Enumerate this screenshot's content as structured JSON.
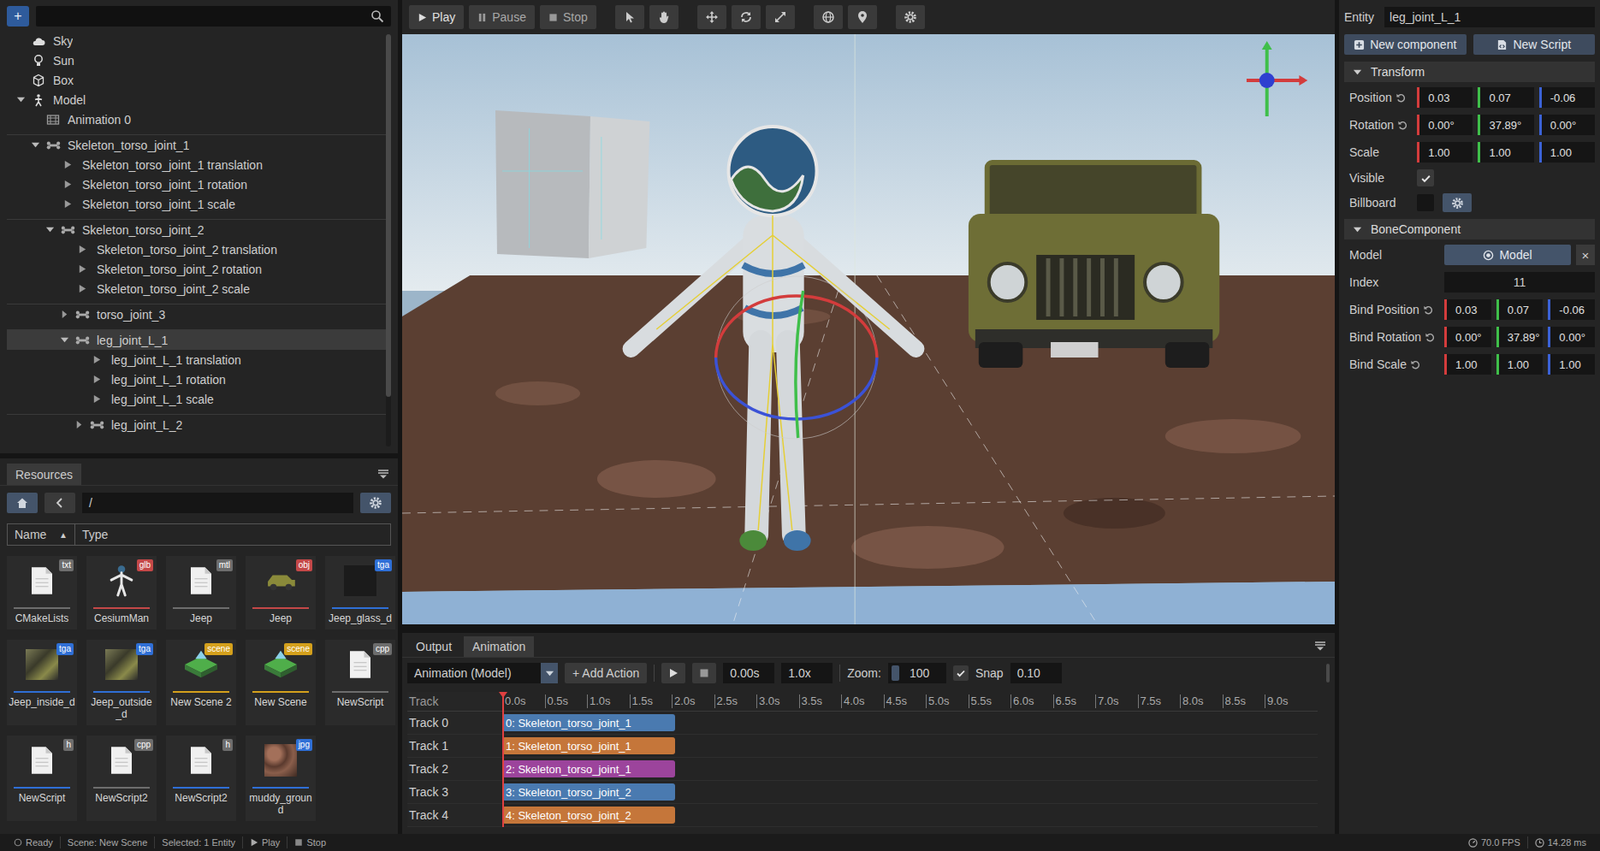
{
  "hierarchy": {
    "add_button": "+",
    "items": [
      {
        "label": "Sky",
        "kind": "sky",
        "depth": 0,
        "selected": false
      },
      {
        "label": "Sun",
        "kind": "light",
        "depth": 0,
        "selected": false
      },
      {
        "label": "Box",
        "kind": "box",
        "depth": 0,
        "selected": false
      },
      {
        "label": "Model",
        "kind": "model",
        "depth": 0,
        "expanded": true,
        "selected": false
      },
      {
        "label": "Animation 0",
        "kind": "animation",
        "depth": 1,
        "selected": false
      },
      {
        "label": "Skeleton_torso_joint_1",
        "kind": "bone",
        "depth": 1,
        "expanded": true,
        "selected": false
      },
      {
        "label": "Skeleton_torso_joint_1 translation",
        "kind": "track",
        "depth": 2,
        "selected": false
      },
      {
        "label": "Skeleton_torso_joint_1 rotation",
        "kind": "track",
        "depth": 2,
        "selected": false
      },
      {
        "label": "Skeleton_torso_joint_1 scale",
        "kind": "track",
        "depth": 2,
        "selected": false
      },
      {
        "label": "Skeleton_torso_joint_2",
        "kind": "bone",
        "depth": 2,
        "expanded": true,
        "selected": false
      },
      {
        "label": "Skeleton_torso_joint_2 translation",
        "kind": "track",
        "depth": 3,
        "selected": false
      },
      {
        "label": "Skeleton_torso_joint_2 rotation",
        "kind": "track",
        "depth": 3,
        "selected": false
      },
      {
        "label": "Skeleton_torso_joint_2 scale",
        "kind": "track",
        "depth": 3,
        "selected": false
      },
      {
        "label": "torso_joint_3",
        "kind": "bone",
        "depth": 3,
        "expanded": false,
        "selected": false
      },
      {
        "label": "leg_joint_L_1",
        "kind": "bone",
        "depth": 3,
        "expanded": true,
        "selected": true
      },
      {
        "label": "leg_joint_L_1 translation",
        "kind": "track",
        "depth": 4,
        "selected": false
      },
      {
        "label": "leg_joint_L_1 rotation",
        "kind": "track",
        "depth": 4,
        "selected": false
      },
      {
        "label": "leg_joint_L_1 scale",
        "kind": "track",
        "depth": 4,
        "selected": false
      },
      {
        "label": "leg_joint_L_2",
        "kind": "bone",
        "depth": 4,
        "expanded": false,
        "selected": false
      }
    ]
  },
  "resources": {
    "tab": "Resources",
    "path": "/",
    "columns": [
      {
        "label": "Name",
        "sort": "▲"
      },
      {
        "label": "Type"
      }
    ],
    "files": [
      {
        "name": "CMakeLists",
        "ext": "txt",
        "kind": "doc",
        "color": "#6d6d6d",
        "line_color": "#6d6d6d"
      },
      {
        "name": "CesiumMan",
        "ext": "glb",
        "kind": "figure",
        "color": "#c44848",
        "line_color": "#c44848"
      },
      {
        "name": "Jeep",
        "ext": "mtl",
        "kind": "doc",
        "color": "#6d6d6d",
        "line_color": "#6d6d6d"
      },
      {
        "name": "Jeep",
        "ext": "obj",
        "kind": "jeep",
        "color": "#c44848",
        "line_color": "#c44848"
      },
      {
        "name": "Jeep_glass_d",
        "ext": "tga",
        "kind": "dark",
        "color": "#2f6fd6",
        "line_color": "#2f6fd6"
      },
      {
        "name": "Jeep_inside_d",
        "ext": "tga",
        "kind": "texture",
        "color": "#2f6fd6",
        "line_color": "#2f6fd6"
      },
      {
        "name": "Jeep_outside_d",
        "ext": "tga",
        "kind": "texture",
        "color": "#2f6fd6",
        "line_color": "#2f6fd6"
      },
      {
        "name": "New Scene 2",
        "ext": "scene",
        "kind": "scene",
        "color": "#d4a01c",
        "line_color": "#d4a01c"
      },
      {
        "name": "New Scene",
        "ext": "scene",
        "kind": "scene",
        "color": "#d4a01c",
        "line_color": "#d4a01c"
      },
      {
        "name": "NewScript",
        "ext": "cpp",
        "kind": "doc",
        "color": "#6d6d6d",
        "line_color": "#6d6d6d"
      },
      {
        "name": "NewScript",
        "ext": "h",
        "kind": "doc",
        "color": "#6d6d6d",
        "line_color": "#2f6fd6"
      },
      {
        "name": "NewScript2",
        "ext": "cpp",
        "kind": "doc",
        "color": "#6d6d6d",
        "line_color": "#6d6d6d"
      },
      {
        "name": "NewScript2",
        "ext": "h",
        "kind": "doc",
        "color": "#6d6d6d",
        "line_color": "#2f6fd6"
      },
      {
        "name": "muddy_ground",
        "ext": "jpg",
        "kind": "mud",
        "color": "#2f6fd6",
        "line_color": "#2f6fd6"
      }
    ]
  },
  "toolbar": {
    "playback": [
      {
        "kind": "play",
        "label": "Play"
      },
      {
        "kind": "pause",
        "label": "Pause"
      },
      {
        "kind": "stop",
        "label": "Stop"
      }
    ],
    "tool_groups": [
      {
        "tools": [
          {
            "kind": "select"
          },
          {
            "kind": "pan"
          }
        ]
      },
      {
        "tools": [
          {
            "kind": "move"
          },
          {
            "kind": "rotate"
          },
          {
            "kind": "scale"
          }
        ]
      },
      {
        "tools": [
          {
            "kind": "world"
          },
          {
            "kind": "pin"
          }
        ]
      },
      {
        "tools": [
          {
            "kind": "settings"
          }
        ]
      }
    ]
  },
  "bottom_panel": {
    "tabs": [
      {
        "label": "Output",
        "selected": false
      },
      {
        "label": "Animation",
        "selected": true
      }
    ],
    "animation": {
      "select": "Animation (Model)",
      "add_action": "+ Add Action",
      "time": "0.00s",
      "speed": "1.0x",
      "zoom_label": "Zoom:",
      "zoom": "100",
      "snap": {
        "checked": true,
        "label": "Snap",
        "value": "0.10"
      }
    },
    "timeline": {
      "header": "Track",
      "ticks": [
        "0.0s",
        "0.5s",
        "1.0s",
        "1.5s",
        "2.0s",
        "2.5s",
        "3.0s",
        "3.5s",
        "4.0s",
        "4.5s",
        "5.0s",
        "5.5s",
        "6.0s",
        "6.5s",
        "7.0s",
        "7.5s",
        "8.0s",
        "8.5s",
        "9.0s"
      ],
      "playhead": 0,
      "tracks": [
        {
          "label": "Track 0",
          "clip": "0: Skeleton_torso_joint_1",
          "color": "#4a7ab0",
          "start": 0,
          "end": 2.0
        },
        {
          "label": "Track 1",
          "clip": "1: Skeleton_torso_joint_1",
          "color": "#c5763a",
          "start": 0,
          "end": 2.0
        },
        {
          "label": "Track 2",
          "clip": "2: Skeleton_torso_joint_1",
          "color": "#9c449c",
          "start": 0,
          "end": 2.0
        },
        {
          "label": "Track 3",
          "clip": "3: Skeleton_torso_joint_2",
          "color": "#4a7ab0",
          "start": 0,
          "end": 2.0
        },
        {
          "label": "Track 4",
          "clip": "4: Skeleton_torso_joint_2",
          "color": "#c5763a",
          "start": 0,
          "end": 2.0
        }
      ]
    }
  },
  "inspector": {
    "entity_label": "Entity",
    "entity": "leg_joint_L_1",
    "buttons": [
      {
        "kind": "component",
        "label": "New component"
      },
      {
        "kind": "script",
        "label": "New Script"
      }
    ],
    "sections": [
      {
        "title": "Transform",
        "expanded": true,
        "rows": [
          {
            "kind": "vector",
            "label": "Position",
            "reset": true,
            "values": [
              "0.03",
              "0.07",
              "-0.06"
            ]
          },
          {
            "kind": "vector",
            "label": "Rotation",
            "reset": true,
            "values": [
              "0.00°",
              "37.89°",
              "0.00°"
            ]
          },
          {
            "kind": "vector",
            "label": "Scale",
            "reset": false,
            "values": [
              "1.00",
              "1.00",
              "1.00"
            ]
          },
          {
            "kind": "checkbox",
            "label": "Visible",
            "checked": true
          },
          {
            "kind": "checkbox-gear",
            "label": "Billboard",
            "checked": false
          }
        ]
      },
      {
        "title": "BoneComponent",
        "expanded": true,
        "rows": [
          {
            "kind": "object",
            "label": "Model",
            "value": "Model",
            "clear": "×"
          },
          {
            "kind": "text",
            "label": "Index",
            "value": "11"
          },
          {
            "kind": "vector",
            "label": "Bind Position",
            "reset": true,
            "values": [
              "0.03",
              "0.07",
              "-0.06"
            ]
          },
          {
            "kind": "vector",
            "label": "Bind Rotation",
            "reset": true,
            "values": [
              "0.00°",
              "37.89°",
              "0.00°"
            ]
          },
          {
            "kind": "vector",
            "label": "Bind Scale",
            "reset": true,
            "values": [
              "1.00",
              "1.00",
              "1.00"
            ]
          }
        ]
      }
    ]
  },
  "status_bar": {
    "left": [
      {
        "kind": "ready",
        "label": "Ready"
      },
      {
        "kind": "text",
        "label": "Scene: New Scene"
      },
      {
        "kind": "text",
        "label": "Selected: 1 Entity"
      },
      {
        "kind": "play",
        "label": "Play"
      },
      {
        "kind": "stop",
        "label": "Stop"
      }
    ],
    "right": [
      {
        "kind": "fps",
        "label": "70.0 FPS"
      },
      {
        "kind": "time",
        "label": "14.28 ms"
      }
    ]
  }
}
